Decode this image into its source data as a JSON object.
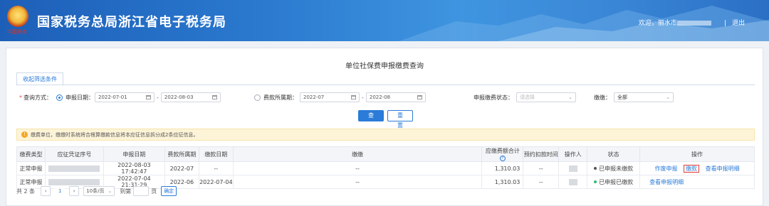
{
  "header": {
    "emblem_text": "中国税务",
    "site_title": "国家税务总局浙江省电子税务局",
    "welcome_prefix": "欢迎，丽水市",
    "logout": "退出"
  },
  "page": {
    "title": "单位社保费申报缴费查询",
    "filter_tab": "收起筛选条件"
  },
  "filters": {
    "query_method_label": "查询方式：",
    "by_declare_date_label": "申报日期：",
    "declare_date_from": "2022-07-01",
    "declare_date_to": "2022-08-03",
    "by_fee_period_label": "费款所属期：",
    "fee_period_from": "2022-07",
    "fee_period_to": "2022-08",
    "pay_status_label": "申报缴费状态：",
    "pay_status_placeholder": "请选择",
    "payment_label": "缴缴：",
    "payment_value": "全部",
    "query_button": "查 询",
    "reset_button": "重 置"
  },
  "notice": {
    "icon": "!",
    "text": "缴费单位，缴缴时系统将合根算缴款信息将本应征信息拆分成2条应征信息。"
  },
  "table": {
    "columns": [
      "缴费类型",
      "应征凭证序号",
      "申报日期",
      "费款所属期",
      "缴款日期",
      "缴缴",
      "应缴费额合计",
      "预约扣款时间",
      "操作人",
      "状态",
      "操作"
    ],
    "rows": [
      {
        "type": "正常申报",
        "declare_date": "2022-08-03 17:42:47",
        "fee_period": "2022-07",
        "pay_date": "--",
        "payment": "--",
        "amount": "1,310.03",
        "reserve_time": "--",
        "status": "已申报未缴款",
        "status_color": "#555555",
        "actions": [
          "作废申报",
          "缴款",
          "查看申报明细"
        ]
      },
      {
        "type": "正常申报",
        "declare_date": "2022-07-04 21:31:29",
        "fee_period": "2022-06",
        "pay_date": "2022-07-04",
        "payment": "--",
        "amount": "1,310.03",
        "reserve_time": "--",
        "status": "已申报已缴款",
        "status_color": "#2ebd6b",
        "actions": [
          "查看申报明细"
        ]
      }
    ]
  },
  "pager": {
    "total": "共 2 条",
    "prev": "‹",
    "page": "1",
    "next": "›",
    "page_size": "10条/页",
    "goto_label": "到第",
    "page_unit": "页",
    "confirm": "确定"
  },
  "colors": {
    "accent": "#2b7bd8",
    "highlight_border": "#e53935"
  }
}
